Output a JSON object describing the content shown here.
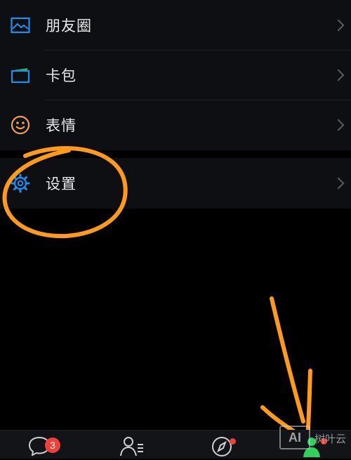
{
  "menu": {
    "items": [
      {
        "label": "朋友圈",
        "icon": "moments-icon"
      },
      {
        "label": "卡包",
        "icon": "card-wallet-icon"
      },
      {
        "label": "表情",
        "icon": "emoji-face-icon"
      },
      {
        "label": "设置",
        "icon": "settings-gear-icon"
      }
    ]
  },
  "tabbar": {
    "tabs": [
      {
        "name": "chats",
        "icon": "chat-bubble-icon"
      },
      {
        "name": "contacts",
        "icon": "contacts-icon"
      },
      {
        "name": "discover",
        "icon": "compass-icon"
      },
      {
        "name": "me",
        "icon": "person-icon"
      }
    ],
    "chats_badge": "3"
  },
  "watermark": {
    "logo_text": "AI",
    "text": "树叶云"
  },
  "colors": {
    "background": "#000000",
    "menu_background": "#0d0f12",
    "icon_blue": "#1e8ef0",
    "icon_orange": "#f0a050",
    "annotation_orange": "#ff9a1a",
    "badge_red": "#f1403c",
    "active_green": "#2fd15c"
  }
}
